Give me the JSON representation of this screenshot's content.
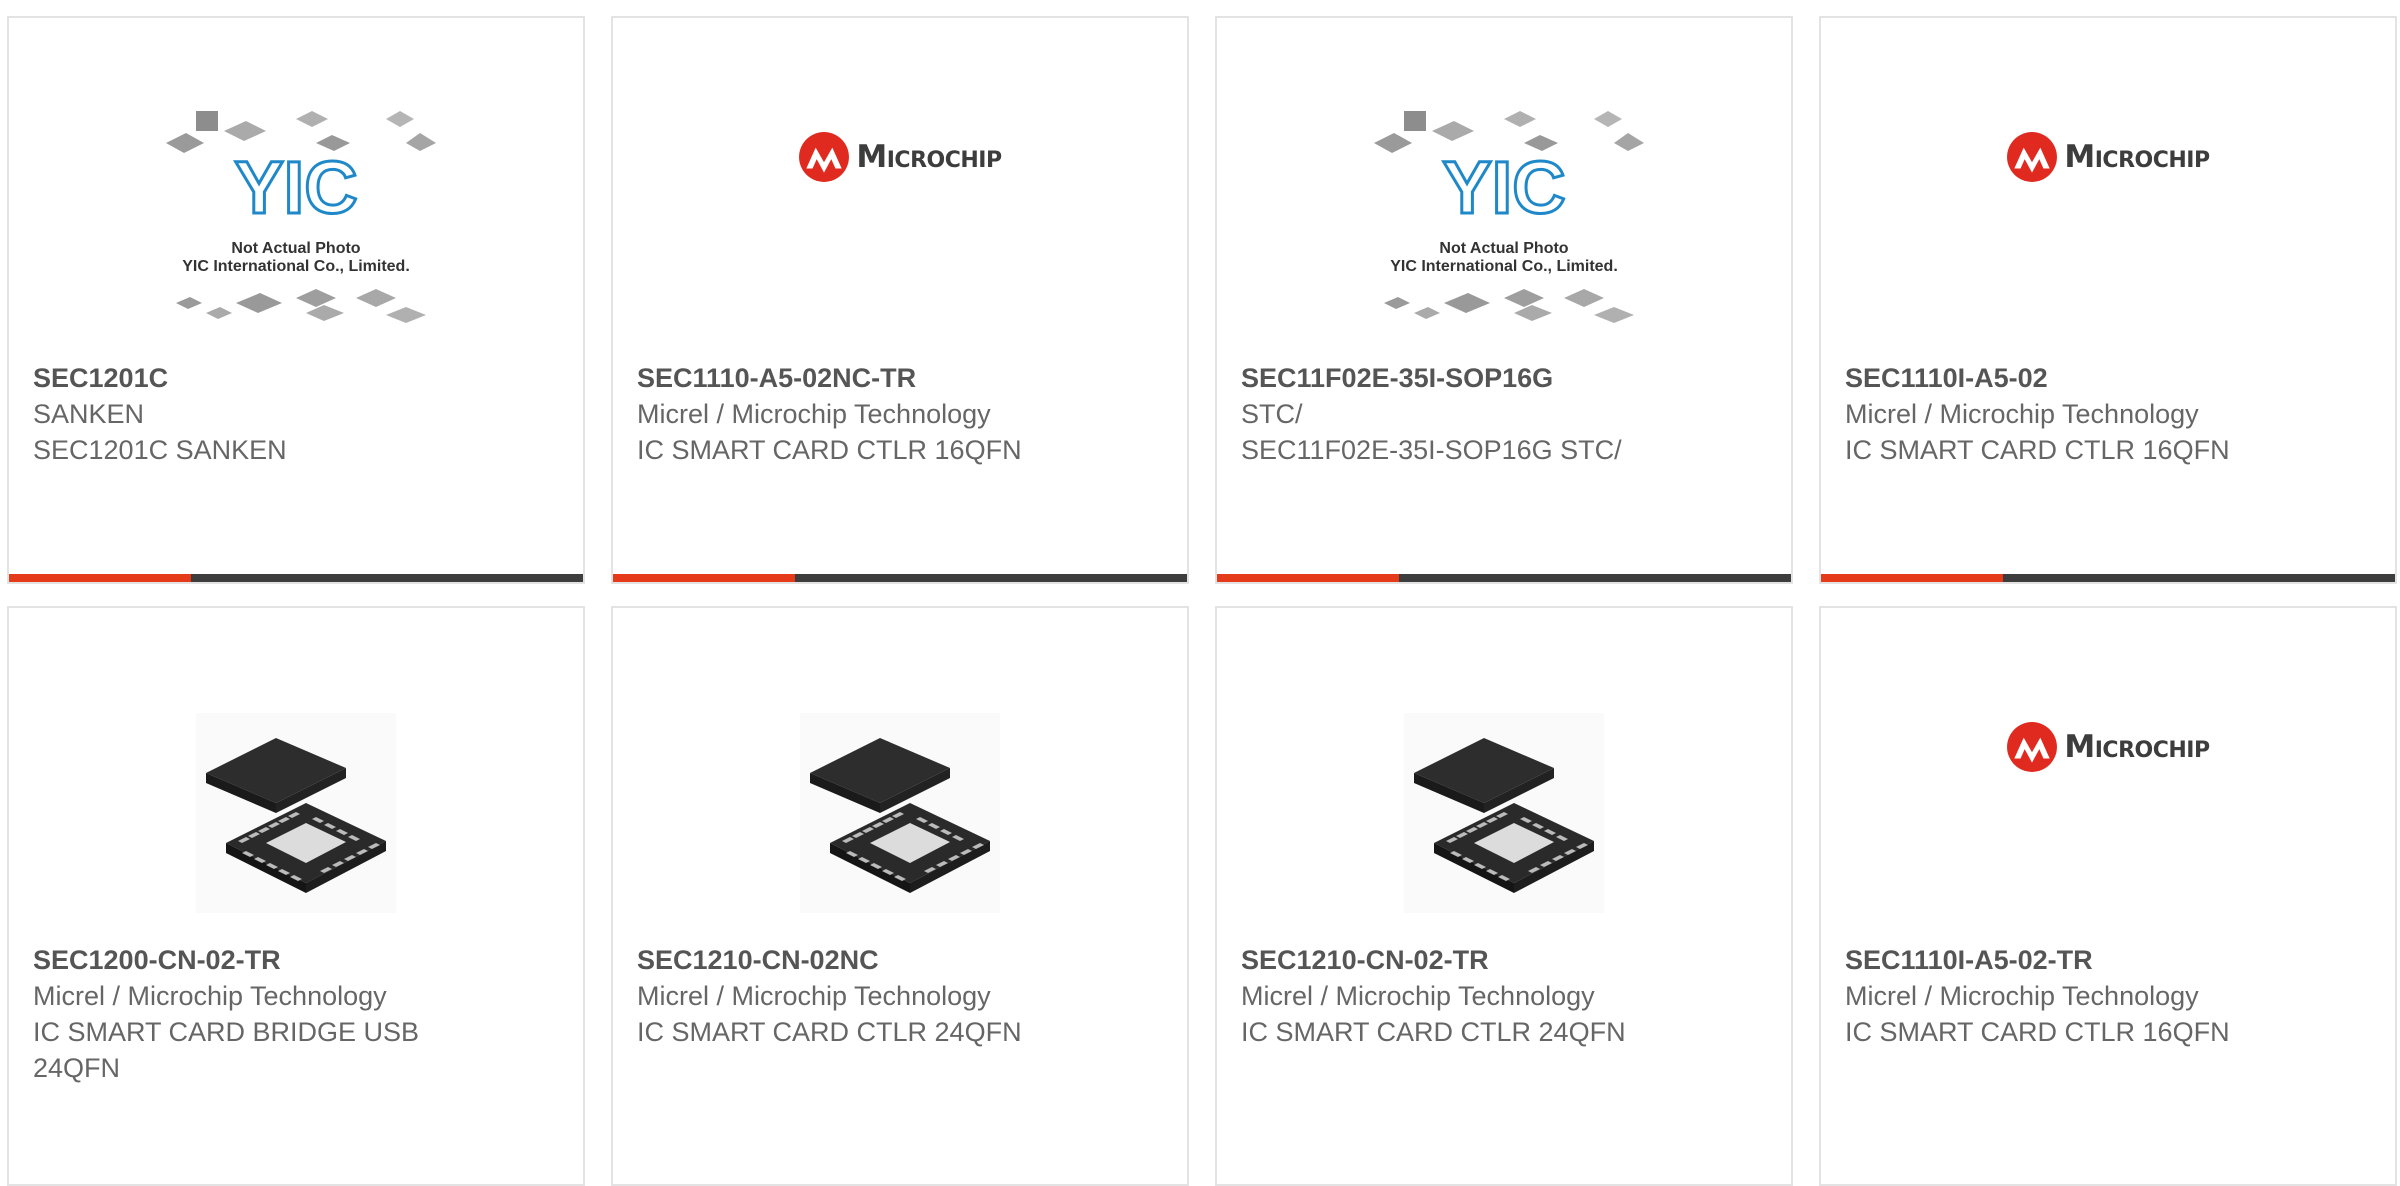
{
  "cards": [
    {
      "part": "SEC1201C",
      "manufacturer": "SANKEN",
      "description": "SEC1201C SANKEN",
      "image": "yic-placeholder-image",
      "placeholder": {
        "line1": "Not Actual Photo",
        "line2": "YIC International Co., Limited.",
        "brand": "YIC"
      }
    },
    {
      "part": "SEC1110-A5-02NC-TR",
      "manufacturer": "Micrel / Microchip Technology",
      "description": "IC SMART CARD CTLR 16QFN",
      "image": "microchip-logo",
      "logo_text": "Microchip"
    },
    {
      "part": "SEC11F02E-35I-SOP16G",
      "manufacturer": "STC/",
      "description": "SEC11F02E-35I-SOP16G STC/",
      "image": "yic-placeholder-image",
      "placeholder": {
        "line1": "Not Actual Photo",
        "line2": "YIC International Co., Limited.",
        "brand": "YIC"
      }
    },
    {
      "part": "SEC1110I-A5-02",
      "manufacturer": "Micrel / Microchip Technology",
      "description": "IC SMART CARD CTLR 16QFN",
      "image": "microchip-logo",
      "logo_text": "Microchip"
    },
    {
      "part": "SEC1200-CN-02-TR",
      "manufacturer": "Micrel / Microchip Technology",
      "description": "IC SMART CARD BRIDGE USB 24QFN",
      "image": "qfn-chip-image"
    },
    {
      "part": "SEC1210-CN-02NC",
      "manufacturer": "Micrel / Microchip Technology",
      "description": "IC SMART CARD CTLR 24QFN",
      "image": "qfn-chip-image"
    },
    {
      "part": "SEC1210-CN-02-TR",
      "manufacturer": "Micrel / Microchip Technology",
      "description": "IC SMART CARD CTLR 24QFN",
      "image": "qfn-chip-image"
    },
    {
      "part": "SEC1110I-A5-02-TR",
      "manufacturer": "Micrel / Microchip Technology",
      "description": "IC SMART CARD CTLR 16QFN",
      "image": "microchip-logo",
      "logo_text": "Microchip"
    }
  ],
  "colors": {
    "accent": "#e53b1a",
    "bar": "#3d3d3d",
    "border": "#e3e3e3",
    "text": "#555555",
    "microchip_red": "#e02a1f"
  }
}
